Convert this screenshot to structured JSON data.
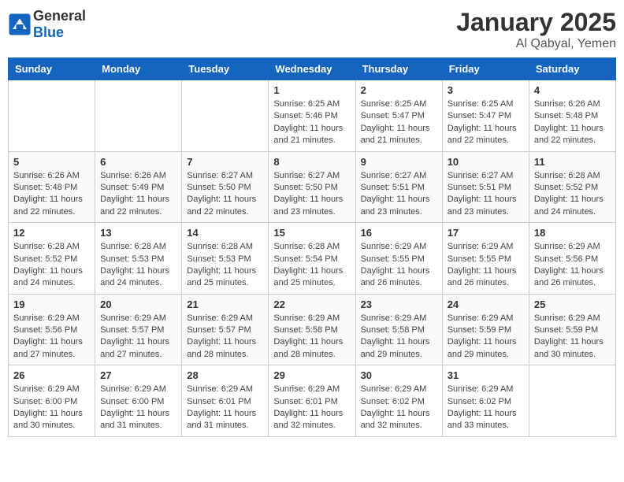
{
  "logo": {
    "text_general": "General",
    "text_blue": "Blue"
  },
  "title": "January 2025",
  "subtitle": "Al Qabyal, Yemen",
  "days_of_week": [
    "Sunday",
    "Monday",
    "Tuesday",
    "Wednesday",
    "Thursday",
    "Friday",
    "Saturday"
  ],
  "weeks": [
    [
      {
        "day": "",
        "info": ""
      },
      {
        "day": "",
        "info": ""
      },
      {
        "day": "",
        "info": ""
      },
      {
        "day": "1",
        "info": "Sunrise: 6:25 AM\nSunset: 5:46 PM\nDaylight: 11 hours and 21 minutes."
      },
      {
        "day": "2",
        "info": "Sunrise: 6:25 AM\nSunset: 5:47 PM\nDaylight: 11 hours and 21 minutes."
      },
      {
        "day": "3",
        "info": "Sunrise: 6:25 AM\nSunset: 5:47 PM\nDaylight: 11 hours and 22 minutes."
      },
      {
        "day": "4",
        "info": "Sunrise: 6:26 AM\nSunset: 5:48 PM\nDaylight: 11 hours and 22 minutes."
      }
    ],
    [
      {
        "day": "5",
        "info": "Sunrise: 6:26 AM\nSunset: 5:48 PM\nDaylight: 11 hours and 22 minutes."
      },
      {
        "day": "6",
        "info": "Sunrise: 6:26 AM\nSunset: 5:49 PM\nDaylight: 11 hours and 22 minutes."
      },
      {
        "day": "7",
        "info": "Sunrise: 6:27 AM\nSunset: 5:50 PM\nDaylight: 11 hours and 22 minutes."
      },
      {
        "day": "8",
        "info": "Sunrise: 6:27 AM\nSunset: 5:50 PM\nDaylight: 11 hours and 23 minutes."
      },
      {
        "day": "9",
        "info": "Sunrise: 6:27 AM\nSunset: 5:51 PM\nDaylight: 11 hours and 23 minutes."
      },
      {
        "day": "10",
        "info": "Sunrise: 6:27 AM\nSunset: 5:51 PM\nDaylight: 11 hours and 23 minutes."
      },
      {
        "day": "11",
        "info": "Sunrise: 6:28 AM\nSunset: 5:52 PM\nDaylight: 11 hours and 24 minutes."
      }
    ],
    [
      {
        "day": "12",
        "info": "Sunrise: 6:28 AM\nSunset: 5:52 PM\nDaylight: 11 hours and 24 minutes."
      },
      {
        "day": "13",
        "info": "Sunrise: 6:28 AM\nSunset: 5:53 PM\nDaylight: 11 hours and 24 minutes."
      },
      {
        "day": "14",
        "info": "Sunrise: 6:28 AM\nSunset: 5:53 PM\nDaylight: 11 hours and 25 minutes."
      },
      {
        "day": "15",
        "info": "Sunrise: 6:28 AM\nSunset: 5:54 PM\nDaylight: 11 hours and 25 minutes."
      },
      {
        "day": "16",
        "info": "Sunrise: 6:29 AM\nSunset: 5:55 PM\nDaylight: 11 hours and 26 minutes."
      },
      {
        "day": "17",
        "info": "Sunrise: 6:29 AM\nSunset: 5:55 PM\nDaylight: 11 hours and 26 minutes."
      },
      {
        "day": "18",
        "info": "Sunrise: 6:29 AM\nSunset: 5:56 PM\nDaylight: 11 hours and 26 minutes."
      }
    ],
    [
      {
        "day": "19",
        "info": "Sunrise: 6:29 AM\nSunset: 5:56 PM\nDaylight: 11 hours and 27 minutes."
      },
      {
        "day": "20",
        "info": "Sunrise: 6:29 AM\nSunset: 5:57 PM\nDaylight: 11 hours and 27 minutes."
      },
      {
        "day": "21",
        "info": "Sunrise: 6:29 AM\nSunset: 5:57 PM\nDaylight: 11 hours and 28 minutes."
      },
      {
        "day": "22",
        "info": "Sunrise: 6:29 AM\nSunset: 5:58 PM\nDaylight: 11 hours and 28 minutes."
      },
      {
        "day": "23",
        "info": "Sunrise: 6:29 AM\nSunset: 5:58 PM\nDaylight: 11 hours and 29 minutes."
      },
      {
        "day": "24",
        "info": "Sunrise: 6:29 AM\nSunset: 5:59 PM\nDaylight: 11 hours and 29 minutes."
      },
      {
        "day": "25",
        "info": "Sunrise: 6:29 AM\nSunset: 5:59 PM\nDaylight: 11 hours and 30 minutes."
      }
    ],
    [
      {
        "day": "26",
        "info": "Sunrise: 6:29 AM\nSunset: 6:00 PM\nDaylight: 11 hours and 30 minutes."
      },
      {
        "day": "27",
        "info": "Sunrise: 6:29 AM\nSunset: 6:00 PM\nDaylight: 11 hours and 31 minutes."
      },
      {
        "day": "28",
        "info": "Sunrise: 6:29 AM\nSunset: 6:01 PM\nDaylight: 11 hours and 31 minutes."
      },
      {
        "day": "29",
        "info": "Sunrise: 6:29 AM\nSunset: 6:01 PM\nDaylight: 11 hours and 32 minutes."
      },
      {
        "day": "30",
        "info": "Sunrise: 6:29 AM\nSunset: 6:02 PM\nDaylight: 11 hours and 32 minutes."
      },
      {
        "day": "31",
        "info": "Sunrise: 6:29 AM\nSunset: 6:02 PM\nDaylight: 11 hours and 33 minutes."
      },
      {
        "day": "",
        "info": ""
      }
    ]
  ]
}
